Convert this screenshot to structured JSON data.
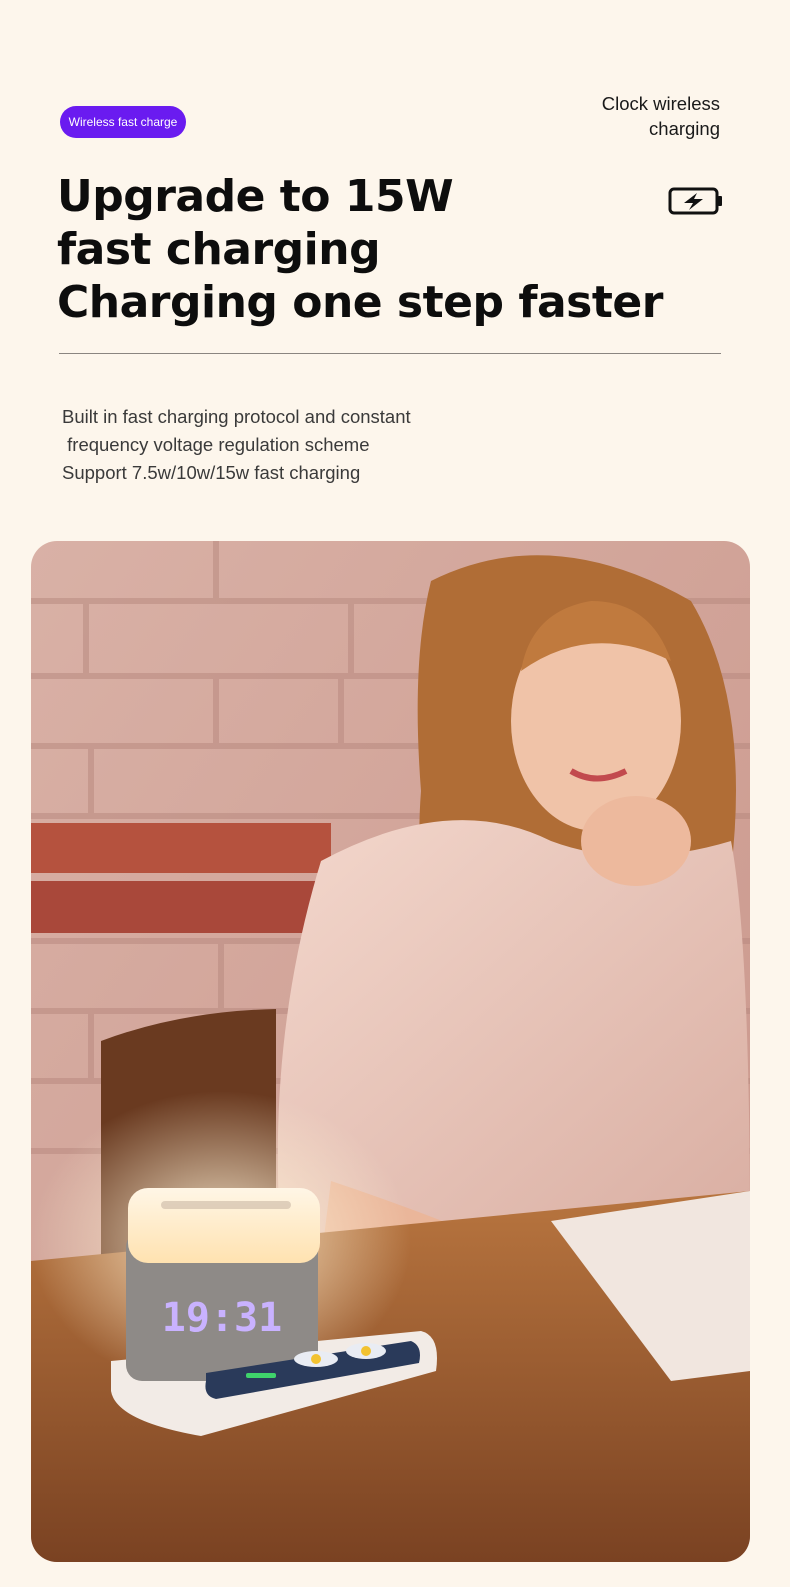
{
  "badge": {
    "label": "Wireless fast charge",
    "color": "#6a1bf0"
  },
  "corner_label": {
    "line1": "Clock wireless",
    "line2": "charging"
  },
  "icons": {
    "battery": "battery-charging-icon"
  },
  "headline": {
    "line1": "Upgrade to 15W",
    "line2": "fast charging",
    "line3": "Charging one step faster"
  },
  "description": {
    "line1": "Built in fast charging protocol and constant",
    "line2": " frequency voltage regulation scheme",
    "line3": "Support 7.5w/10w/15w fast charging"
  },
  "photo": {
    "clock_display": "19:31"
  },
  "colors": {
    "background": "#fdf6ec",
    "accent": "#6a1bf0",
    "text": "#0d0d0d"
  }
}
